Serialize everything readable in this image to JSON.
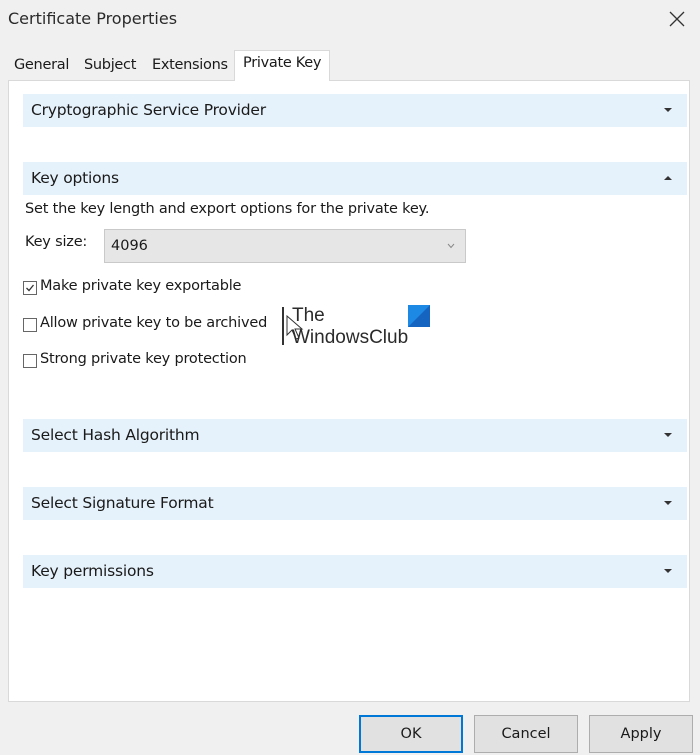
{
  "window": {
    "title": "Certificate Properties",
    "close_icon": "close-icon"
  },
  "tabs": [
    {
      "label": "General",
      "active": false
    },
    {
      "label": "Subject",
      "active": false
    },
    {
      "label": "Extensions",
      "active": false
    },
    {
      "label": "Private Key",
      "active": true
    }
  ],
  "sections": {
    "csp": {
      "label": "Cryptographic Service Provider",
      "expanded": false
    },
    "key_options": {
      "label": "Key options",
      "expanded": true,
      "description": "Set the key length and export options for the private key.",
      "key_size_label": "Key size:",
      "key_size_value": "4096",
      "checkboxes": [
        {
          "label": "Make private key exportable",
          "checked": true
        },
        {
          "label": "Allow private key to be archived",
          "checked": false
        },
        {
          "label": "Strong private key protection",
          "checked": false
        }
      ]
    },
    "hash": {
      "label": "Select Hash Algorithm",
      "expanded": false
    },
    "signature": {
      "label": "Select Signature Format",
      "expanded": false
    },
    "permissions": {
      "label": "Key permissions",
      "expanded": false
    }
  },
  "watermark": {
    "line1": "The",
    "line2": "WindowsClub",
    "logo_color": "#1e88e5"
  },
  "buttons": {
    "ok": "OK",
    "cancel": "Cancel",
    "apply": "Apply"
  },
  "colors": {
    "section_header_bg": "#e6f2fb",
    "primary_border": "#0078d7"
  }
}
